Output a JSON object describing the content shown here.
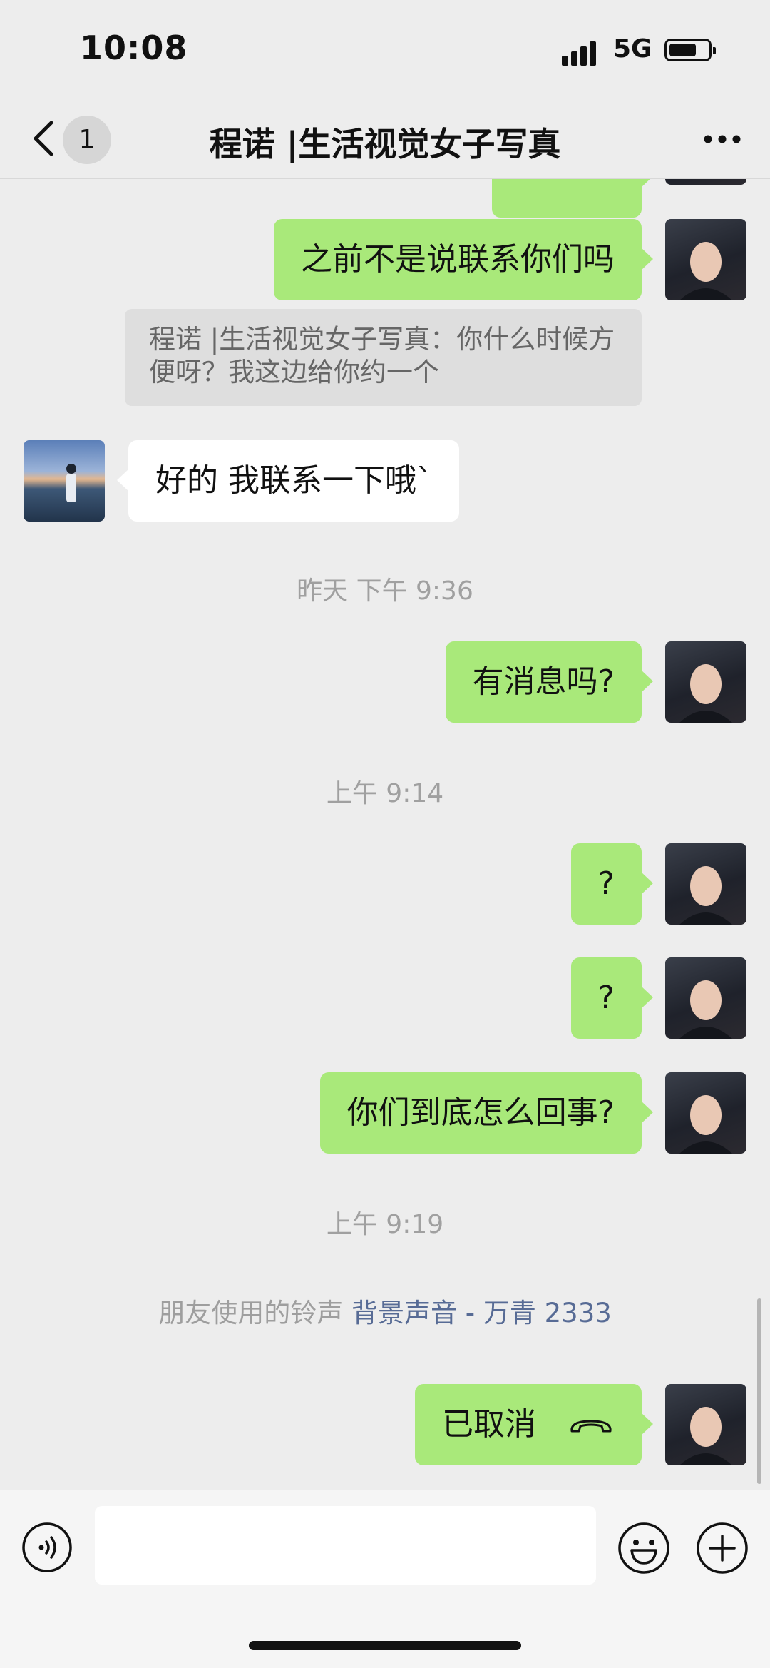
{
  "status_bar": {
    "time": "10:08",
    "network": "5G",
    "battery_level": 0.72
  },
  "nav": {
    "back_badge": "1",
    "title": "程诺 |生活视觉女子写真"
  },
  "messages": {
    "m1": "之前不是说联系你们吗",
    "quote": "程诺 |生活视觉女子写真：你什么时候方便呀？我这边给你约一个",
    "m2": "好的 我联系一下哦`",
    "ts1": "昨天 下午 9:36",
    "m3": "有消息吗?",
    "ts2": "上午 9:14",
    "m4": "?",
    "m5": "?",
    "m6": "你们到底怎么回事?",
    "ts3": "上午 9:19",
    "ringtone_label": "朋友使用的铃声",
    "ringtone_song": "背景声音 - 万青 2333",
    "m7": "已取消"
  },
  "input": {
    "placeholder": ""
  },
  "colors": {
    "my_bubble": "#a9e97a",
    "their_bubble": "#ffffff",
    "background": "#ededed",
    "link": "#576b95"
  },
  "icons": [
    "back-icon",
    "more-icon",
    "voice-icon",
    "emoji-icon",
    "plus-icon",
    "hangup-icon"
  ]
}
